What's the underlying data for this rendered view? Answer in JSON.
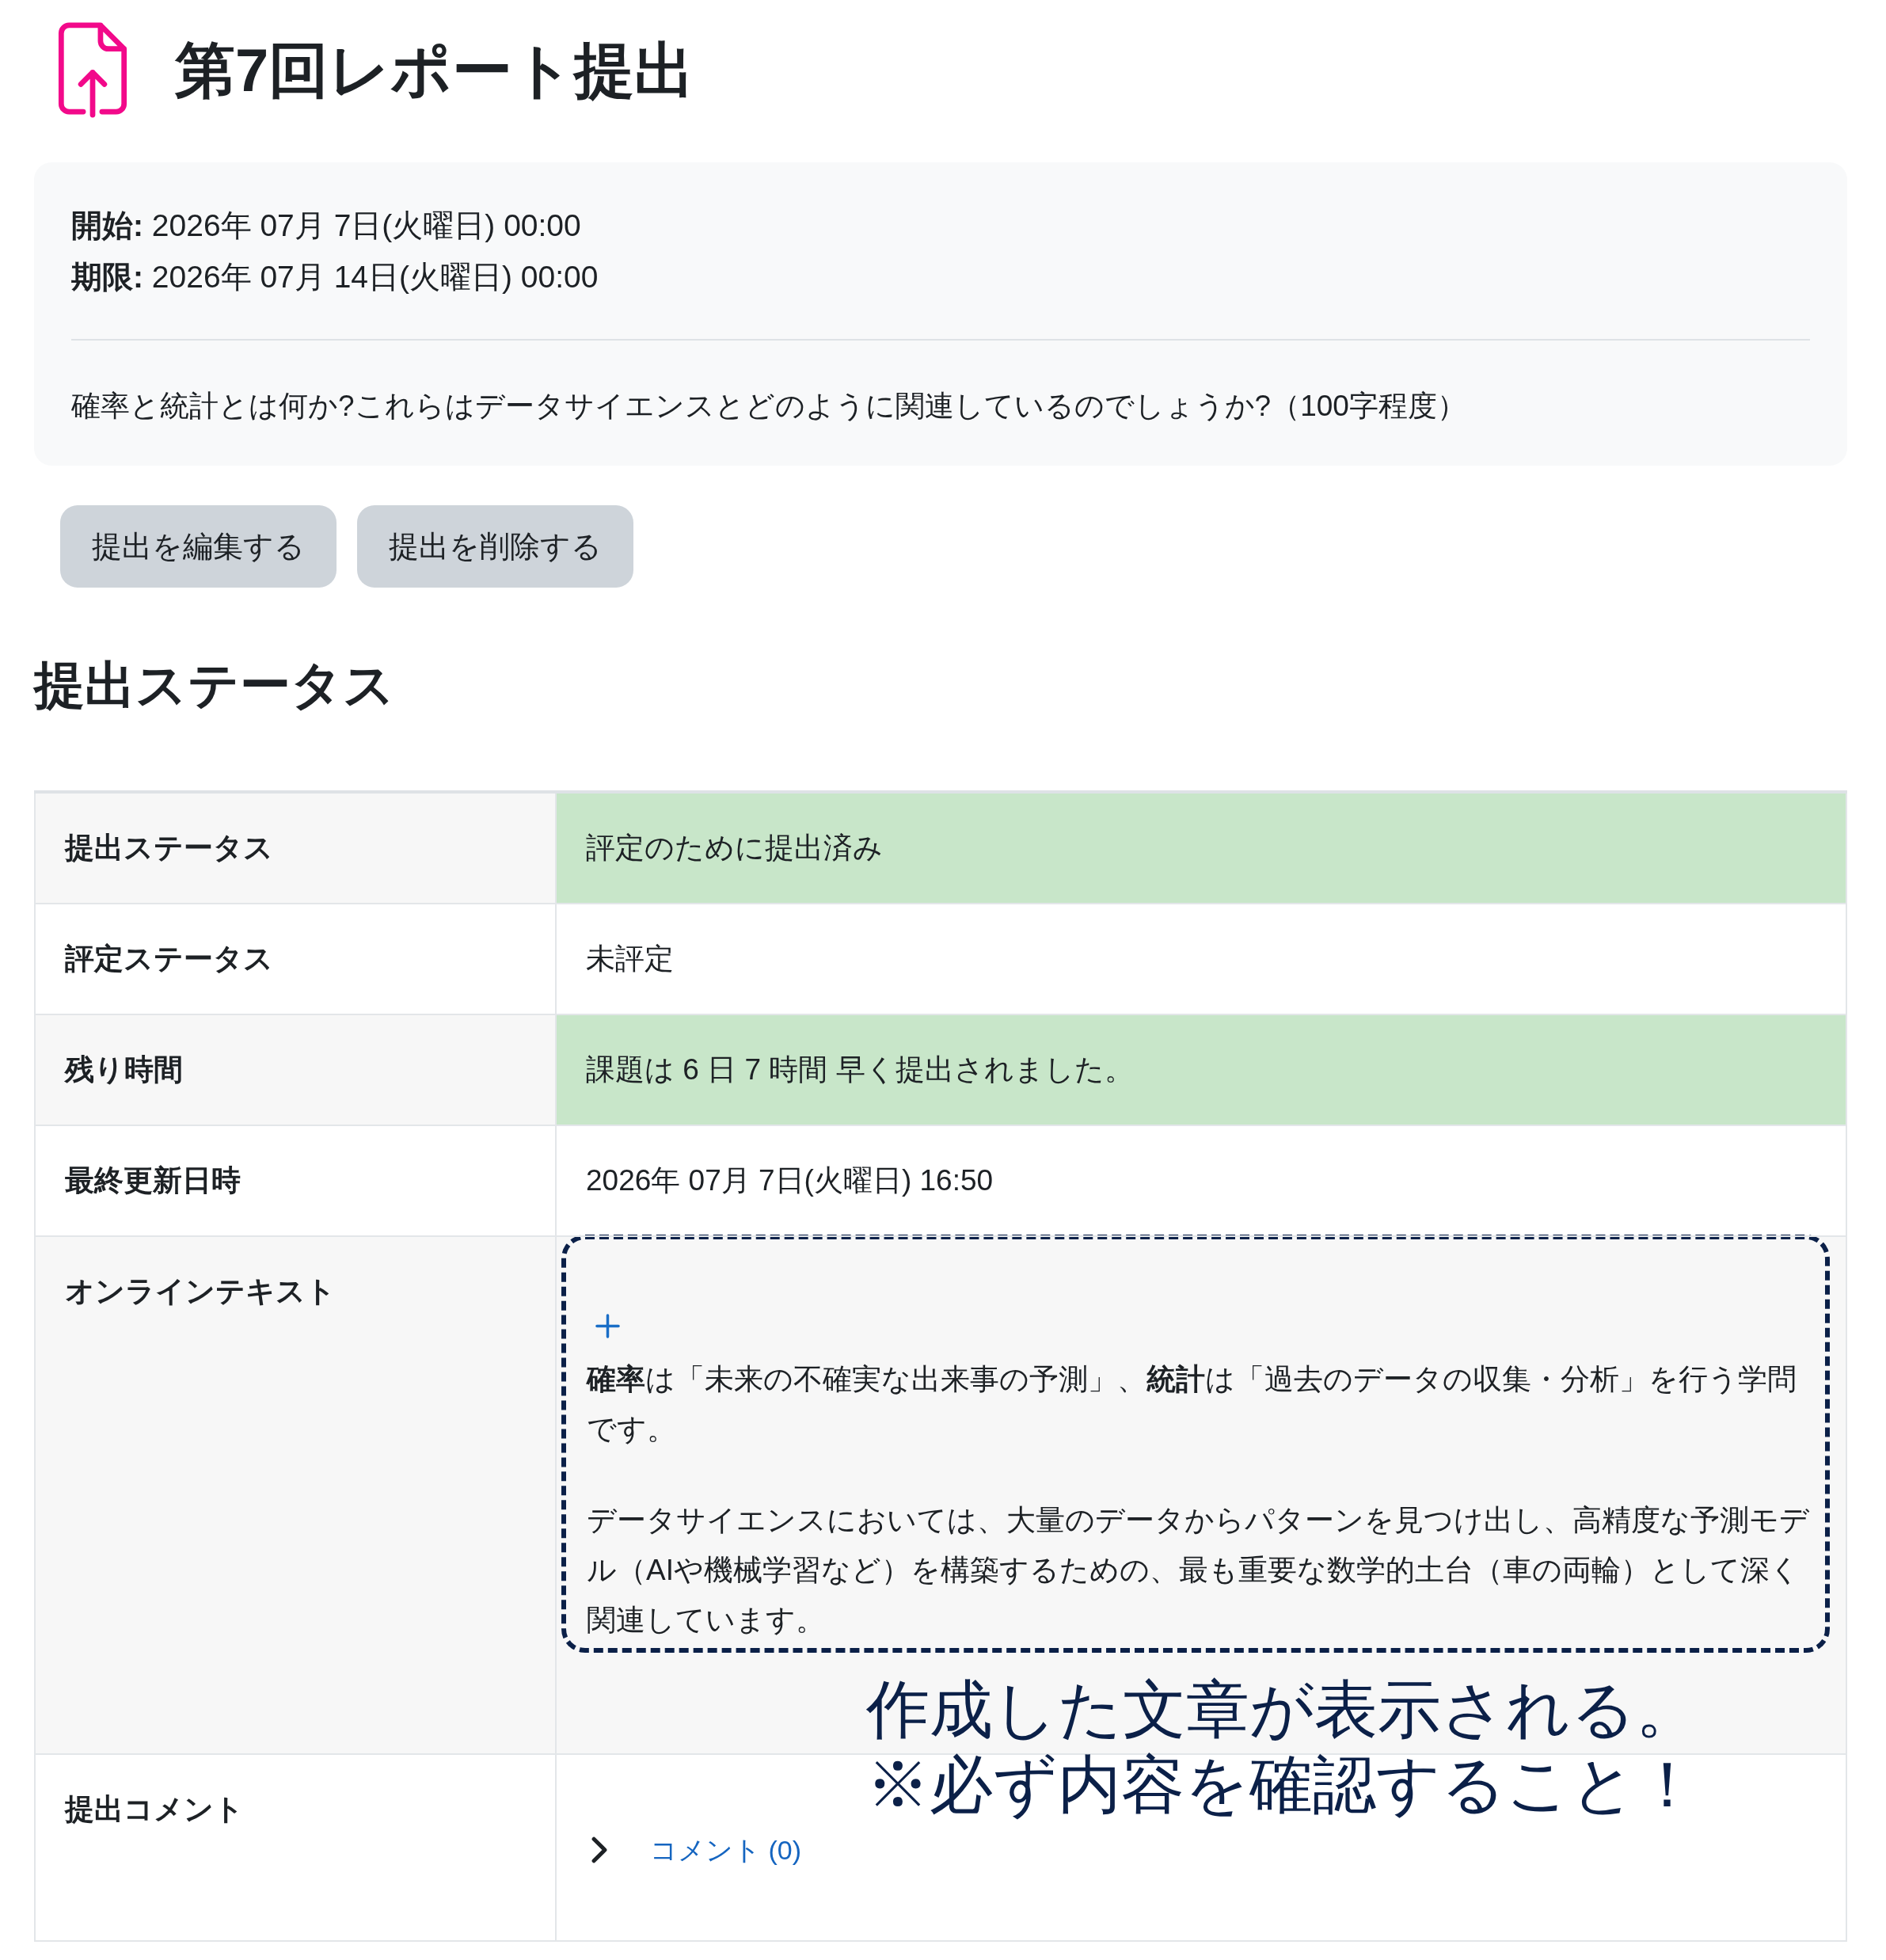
{
  "header": {
    "title": "第7回レポート提出"
  },
  "info": {
    "dates": [
      "**開始:** 2026年 07月 7日(火曜日) 00:00",
      "**期限:** 2026年 07月 14日(火曜日) 00:00"
    ],
    "description": "確率と統計とは何か?これらはデータサイエンスとどのように関連しているのでしょうか?（100字程度）"
  },
  "actions": [
    "提出を編集する",
    "提出を削除する"
  ],
  "status_section": {
    "heading": "提出ステータス",
    "rows": [
      {
        "kind": "text",
        "label": "提出ステータス",
        "value": "評定のために提出済み",
        "highlighted": true
      },
      {
        "kind": "text",
        "label": "評定ステータス",
        "value": "未評定",
        "highlighted": false
      },
      {
        "kind": "text",
        "label": "残り時間",
        "value": "課題は 6 日 7 時間 早く提出されました。",
        "highlighted": true
      },
      {
        "kind": "text",
        "label": "最終更新日時",
        "value": "2026年 07月 7日(火曜日) 16:50",
        "highlighted": false
      },
      {
        "kind": "online_text",
        "label": "オンラインテキスト",
        "highlighted": false,
        "paragraphs": [
          "**確率**は「未来の不確実な出来事の予測」、**統計**は「過去のデータの収集・分析」を行う学問です。",
          "データサイエンスにおいては、大量のデータからパターンを見つけ出し、高精度な予測モデル（AIや機械学習など）を構築するための、最も重要な数学的土台（車の両輪）として深く関連しています。"
        ]
      },
      {
        "kind": "comments",
        "label": "提出コメント",
        "highlighted": false,
        "link": "コメント (0)",
        "expanded": false
      }
    ]
  },
  "annotation": {
    "lines": [
      "作成した文章が表示される。",
      "※必ず内容を確認すること！"
    ]
  }
}
